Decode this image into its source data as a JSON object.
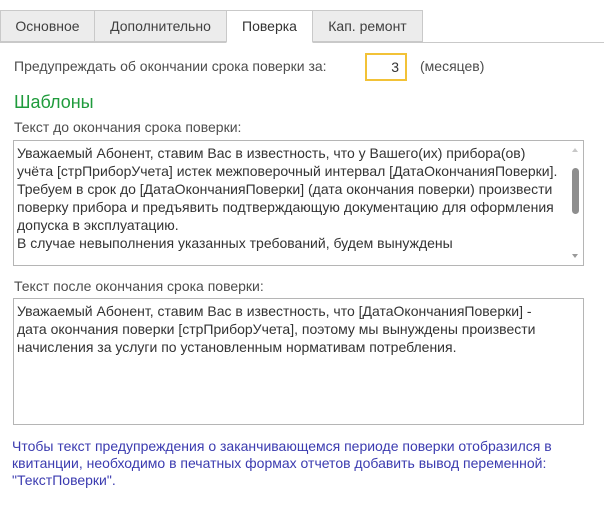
{
  "tabs": [
    {
      "label": "Основное",
      "active": false
    },
    {
      "label": "Дополнительно",
      "active": false
    },
    {
      "label": "Поверка",
      "active": true
    },
    {
      "label": "Кап. ремонт",
      "active": false
    }
  ],
  "warning": {
    "label": "Предупреждать об окончании срока поверки за:",
    "months_value": "3",
    "unit_label": "(месяцев)"
  },
  "templates": {
    "title": "Шаблоны",
    "before_label": "Текст до окончания срока поверки:",
    "before_text": "Уважаемый Абонент, ставим Вас в известность, что у Вашего(их) прибора(ов) учёта [стрПриборУчета] истек межповерочный интервал [ДатаОкончанияПоверки].\nТребуем в срок до [ДатаОкончанияПоверки] (дата окончания поверки) произвести поверку прибора и предъявить подтверждающую документацию для оформления допуска в эксплуатацию.\nВ случае невыполнения указанных требований, будем вынуждены",
    "after_label": "Текст после окончания срока поверки:",
    "after_text": "Уважаемый Абонент, ставим Вас в известность, что [ДатаОкончанияПоверки] - дата окончания поверки [стрПриборУчета], поэтому мы вынуждены произвести начисления за услуги по установленным нормативам потребления."
  },
  "note": "Чтобы текст предупреждения о заканчивающемся периоде поверки отобразился в квитанции, необходимо в печатных формах отчетов добавить вывод переменной: \"ТекстПоверки\".",
  "colors": {
    "accent_green": "#1f9b3c",
    "note_blue": "#3b3bb0",
    "focus_yellow": "#f2c237"
  }
}
